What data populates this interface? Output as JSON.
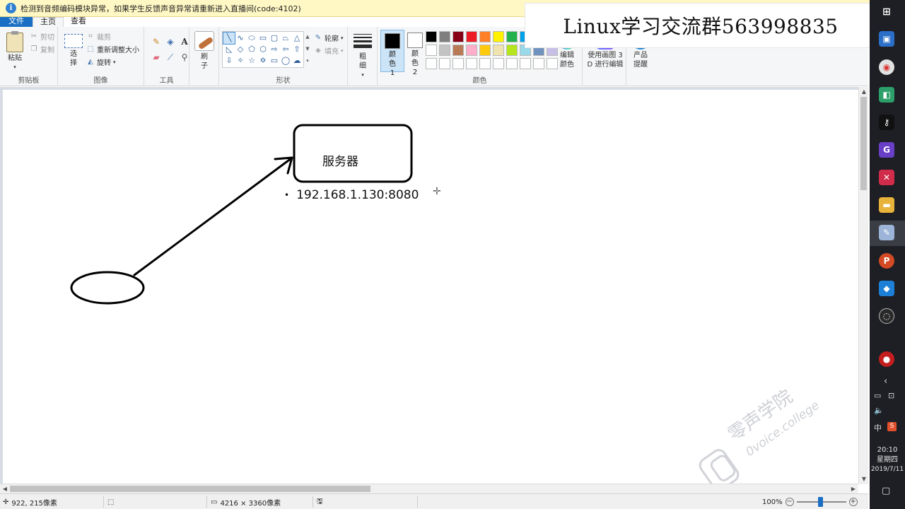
{
  "notification": {
    "text": "检测到音频编码模块异常，如果学生反馈声音异常请重新进入直播间(code:4102)"
  },
  "tabs": [
    {
      "label": "文件"
    },
    {
      "label": "主页"
    },
    {
      "label": "查看"
    }
  ],
  "ribbon": {
    "clipboard": {
      "paste": "粘贴",
      "cut": "剪切",
      "copy": "复制",
      "group": "剪贴板"
    },
    "image": {
      "select": "选择",
      "crop": "裁剪",
      "resize": "重新调整大小",
      "rotate": "旋转",
      "group": "图像"
    },
    "tools": {
      "group": "工具"
    },
    "brushes": {
      "label": "刷子"
    },
    "shapes": {
      "outline": "轮廓",
      "fill": "填充",
      "group": "形状"
    },
    "size": {
      "label": "粗细"
    },
    "colors": {
      "color1": "颜色 1",
      "color2": "颜色 2",
      "edit": "编辑颜色",
      "group": "颜色",
      "color1_value": "#000000",
      "color2_value": "#ffffff",
      "palette": [
        "#000000",
        "#7f7f7f",
        "#880015",
        "#ed1c24",
        "#ff7f27",
        "#fff200",
        "#22b14c",
        "#00a2e8",
        "#3f48cc",
        "#a349a4",
        "#ffffff",
        "#c3c3c3",
        "#b97a57",
        "#ffaec9",
        "#ffc90e",
        "#efe4b0",
        "#b5e61d",
        "#99d9ea",
        "#7092be",
        "#c8bfe7",
        "#ffffff",
        "#ffffff",
        "#ffffff",
        "#ffffff",
        "#ffffff",
        "#ffffff",
        "#ffffff",
        "#ffffff",
        "#ffffff",
        "#ffffff"
      ]
    },
    "paint3d": {
      "label": "使用画图 3D 进行编辑"
    },
    "product": {
      "label": "产品提醒"
    }
  },
  "banner": {
    "text": "Linux学习交流群563998835"
  },
  "canvas": {
    "server_label": "服务器",
    "ip_label": "192.168.1.130:8080"
  },
  "watermark": {
    "line1": "零声学院",
    "line2": "0voice.college"
  },
  "status": {
    "cursor_pos": "922, 215像素",
    "image_size": "4216 × 3360像素",
    "zoom": "100%"
  },
  "taskbar": {
    "input_method": "中",
    "time": "20:10",
    "weekday": "星期四",
    "date": "2019/7/11"
  }
}
